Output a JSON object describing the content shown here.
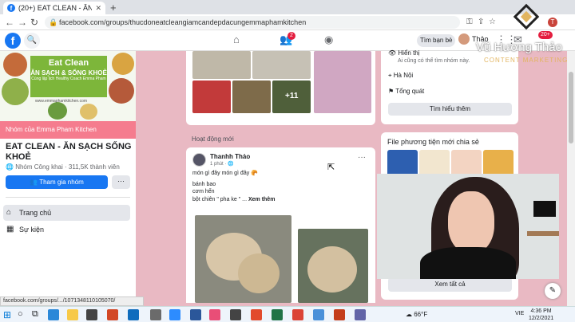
{
  "browser": {
    "tab_title": "(20+) EAT CLEAN - ĂN SẠCH SỐ...",
    "url": "facebook.com/groups/thucdoneatcleangiamcandepdacungemmaphamkitchen",
    "profile_initial": "T"
  },
  "fb": {
    "logo": "f",
    "friends_badge": "2",
    "notif_badge": "20+",
    "find_friends": "Tìm bạn bè",
    "profile_name": "Thảo"
  },
  "group": {
    "cover": {
      "title": "Eat Clean",
      "subtitle": "ĂN SẠCH & SỐNG KHOẺ",
      "tagline": "Cùng lập lịch Healthy Coach Emma Pham",
      "link": "www.emmaphamkitchen.com"
    },
    "owner_strip": "Nhóm của Emma Pham Kitchen",
    "name": "EAT CLEAN - ĂN SẠCH SỐNG KHOẺ",
    "meta": "Nhóm Công khai · 311,5K thành viên",
    "join": "Tham gia nhóm",
    "more": "···",
    "menu": [
      {
        "label": "Trang chủ",
        "icon": "home-icon"
      },
      {
        "label": "Sự kiện",
        "icon": "calendar-icon"
      }
    ]
  },
  "feed": {
    "more_photos": "+11",
    "activity_header": "Hoạt động mới",
    "post": {
      "author": "Thanhh Thảo",
      "time": "1 phút · 🌐",
      "lines": [
        "món gì đây món gì đây 🥐",
        "bánh bao",
        "cơm hến"
      ],
      "last_line": "bột chiên \" pha ke \" ...",
      "see_more": "Xem thêm"
    }
  },
  "about": {
    "items": [
      {
        "title": "Hiển thị",
        "subtitle": "Ai cũng có thể tìm nhóm này.",
        "icon": "eye-icon"
      },
      {
        "title": "Hà Nội",
        "icon": "location-icon"
      },
      {
        "title": "Tổng quát",
        "icon": "tag-icon"
      }
    ],
    "learn_more": "Tìm hiểu thêm"
  },
  "media": {
    "title": "File phương tiện mới chia sẻ",
    "see_all": "Xem tất cả"
  },
  "watermark": {
    "name": "Vũ Hương Thảo",
    "tagline": "CONTENT MARKETING"
  },
  "status_url": "facebook.com/groups/.../1071348110105070/",
  "taskbar": {
    "weather": "66°F",
    "lang": "VIE",
    "time": "4:36 PM",
    "date": "12/2/2021"
  }
}
